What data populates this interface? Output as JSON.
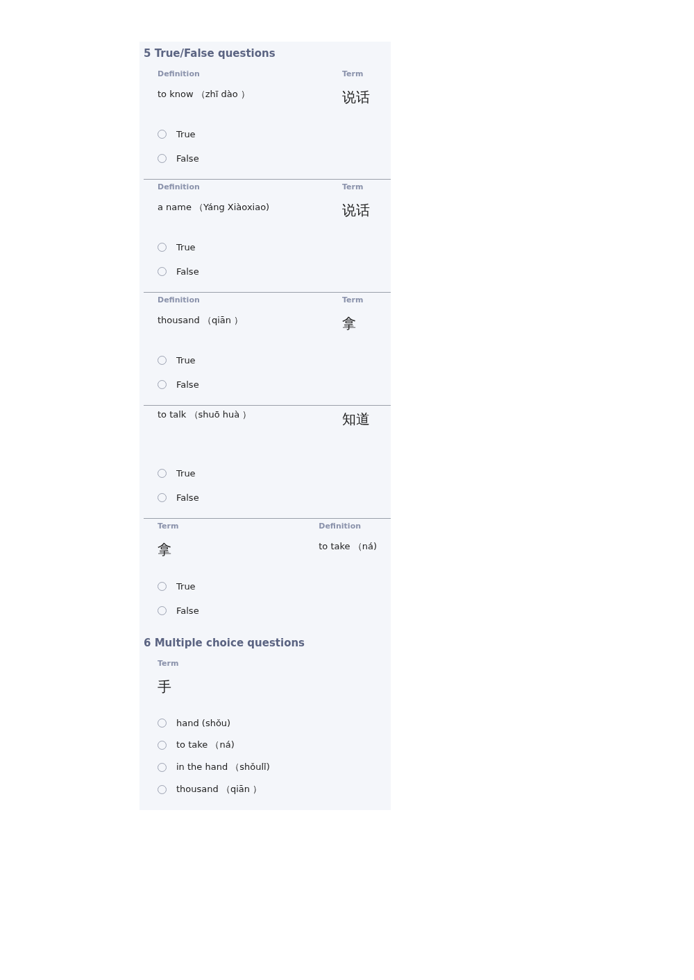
{
  "sections": [
    {
      "title": "5 True/False questions",
      "questions": [
        {
          "left": {
            "label": "Definition",
            "text": "to know （zhī dào ）",
            "kind": "english"
          },
          "right": {
            "label": "Term",
            "text": "说话",
            "kind": "chinese"
          },
          "options": [
            {
              "text": "True",
              "selected": false
            },
            {
              "text": "False",
              "selected": false
            }
          ]
        },
        {
          "left": {
            "label": "Definition",
            "text": "a name （Yáng Xiàoxiao)",
            "kind": "english"
          },
          "right": {
            "label": "Term",
            "text": "说话",
            "kind": "chinese"
          },
          "options": [
            {
              "text": "True",
              "selected": false
            },
            {
              "text": "False",
              "selected": false
            }
          ]
        },
        {
          "left": {
            "label": "Definition",
            "text": "thousand （qiān ）",
            "kind": "english"
          },
          "right": {
            "label": "Term",
            "text": "拿",
            "kind": "chinese"
          },
          "options": [
            {
              "text": "True",
              "selected": false
            },
            {
              "text": "False",
              "selected": false
            }
          ]
        },
        {
          "left": {
            "text": "to talk （shuō huà ）",
            "kind": "english"
          },
          "right": {
            "text": "知道",
            "kind": "chinese"
          },
          "options": [
            {
              "text": "True",
              "selected": false
            },
            {
              "text": "False",
              "selected": false
            }
          ]
        },
        {
          "left": {
            "label": "Term",
            "text": "拿",
            "kind": "chinese"
          },
          "right": {
            "label": "Definition",
            "text": "to take （ná)",
            "kind": "english"
          },
          "options": [
            {
              "text": "True",
              "selected": false
            },
            {
              "text": "False",
              "selected": false
            }
          ]
        }
      ]
    },
    {
      "title": "6 Multiple choice questions",
      "questions": [
        {
          "left": {
            "label": "Term",
            "text": "手",
            "kind": "chinese"
          },
          "options": [
            {
              "text": "hand (shǒu)",
              "selected": false
            },
            {
              "text": "to take （ná)",
              "selected": false
            },
            {
              "text": "in the hand （shǒulǐ)",
              "selected": false
            },
            {
              "text": "thousand （qiān ）",
              "selected": false
            }
          ]
        }
      ]
    }
  ]
}
